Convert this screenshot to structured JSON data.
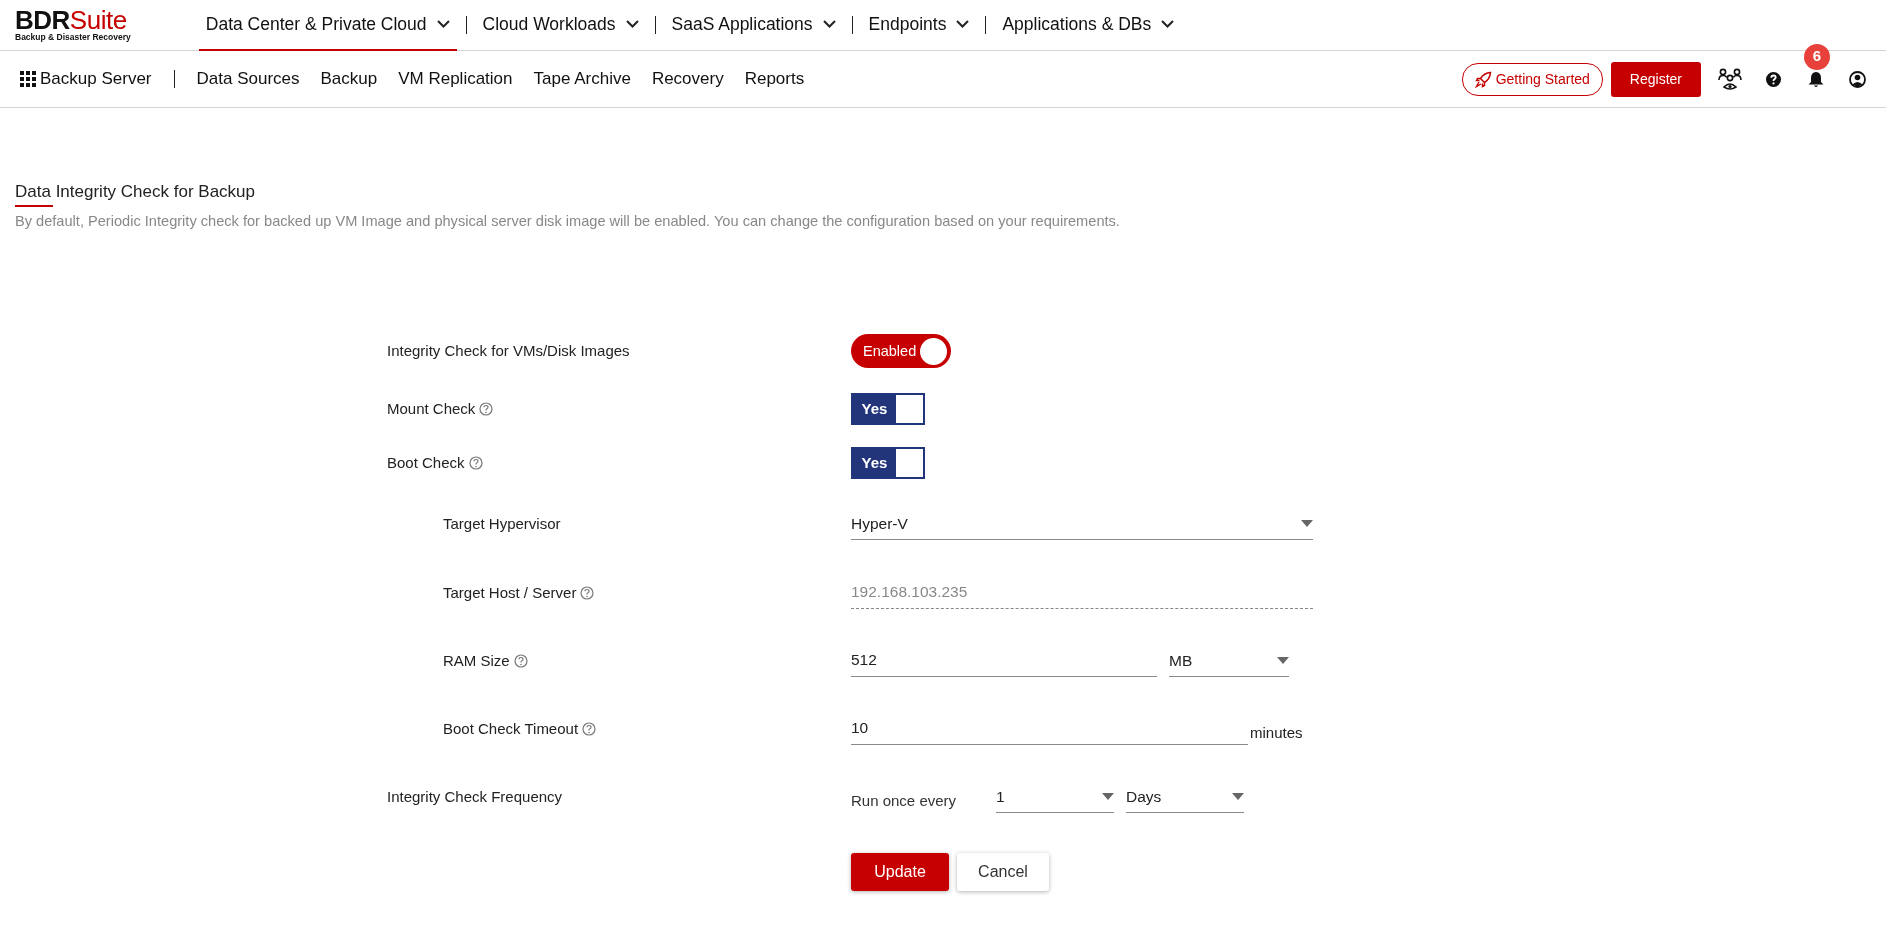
{
  "brand": {
    "name_main": "BDR",
    "name_accent": "Suite",
    "tagline": "Backup & Disaster Recovery"
  },
  "top_nav": [
    {
      "label": "Data Center & Private Cloud",
      "selected": true
    },
    {
      "label": "Cloud Workloads",
      "selected": false
    },
    {
      "label": "SaaS Applications",
      "selected": false
    },
    {
      "label": "Endpoints",
      "selected": false
    },
    {
      "label": "Applications & DBs",
      "selected": false
    }
  ],
  "sub_nav": {
    "title": "Backup Server",
    "items": [
      "Data Sources",
      "Backup",
      "VM Replication",
      "Tape Archive",
      "Recovery",
      "Reports"
    ]
  },
  "actions": {
    "getting_started": "Getting Started",
    "register": "Register",
    "notification_count": "6"
  },
  "page": {
    "title": "Data Integrity Check for Backup",
    "description": "By default, Periodic Integrity check for backed up VM Image and physical server disk image will be enabled. You can change the configuration based on your requirements."
  },
  "form": [
    {
      "kind": "pill-toggle",
      "label": "Integrity Check for VMs/Disk Images",
      "help": false,
      "value": "Enabled",
      "on": true
    },
    {
      "kind": "box-toggle",
      "label": "Mount Check",
      "help": true,
      "value": "Yes",
      "on": true
    },
    {
      "kind": "box-toggle",
      "label": "Boot Check",
      "help": true,
      "value": "Yes",
      "on": true,
      "children": [
        {
          "kind": "select",
          "label": "Target Hypervisor",
          "help": false,
          "value": "Hyper-V"
        },
        {
          "kind": "readonly",
          "label": "Target Host / Server",
          "help": true,
          "placeholder": "192.168.103.235"
        },
        {
          "kind": "number-unit",
          "label": "RAM Size",
          "help": true,
          "value": "512",
          "unit": "MB"
        },
        {
          "kind": "text-suffix",
          "label": "Boot Check Timeout",
          "help": true,
          "value": "10",
          "suffix": "minutes"
        }
      ]
    },
    {
      "kind": "frequency",
      "label": "Integrity Check Frequency",
      "help": false,
      "prefix": "Run once every",
      "count": "1",
      "period": "Days"
    }
  ],
  "buttons": {
    "primary": "Update",
    "secondary": "Cancel"
  }
}
